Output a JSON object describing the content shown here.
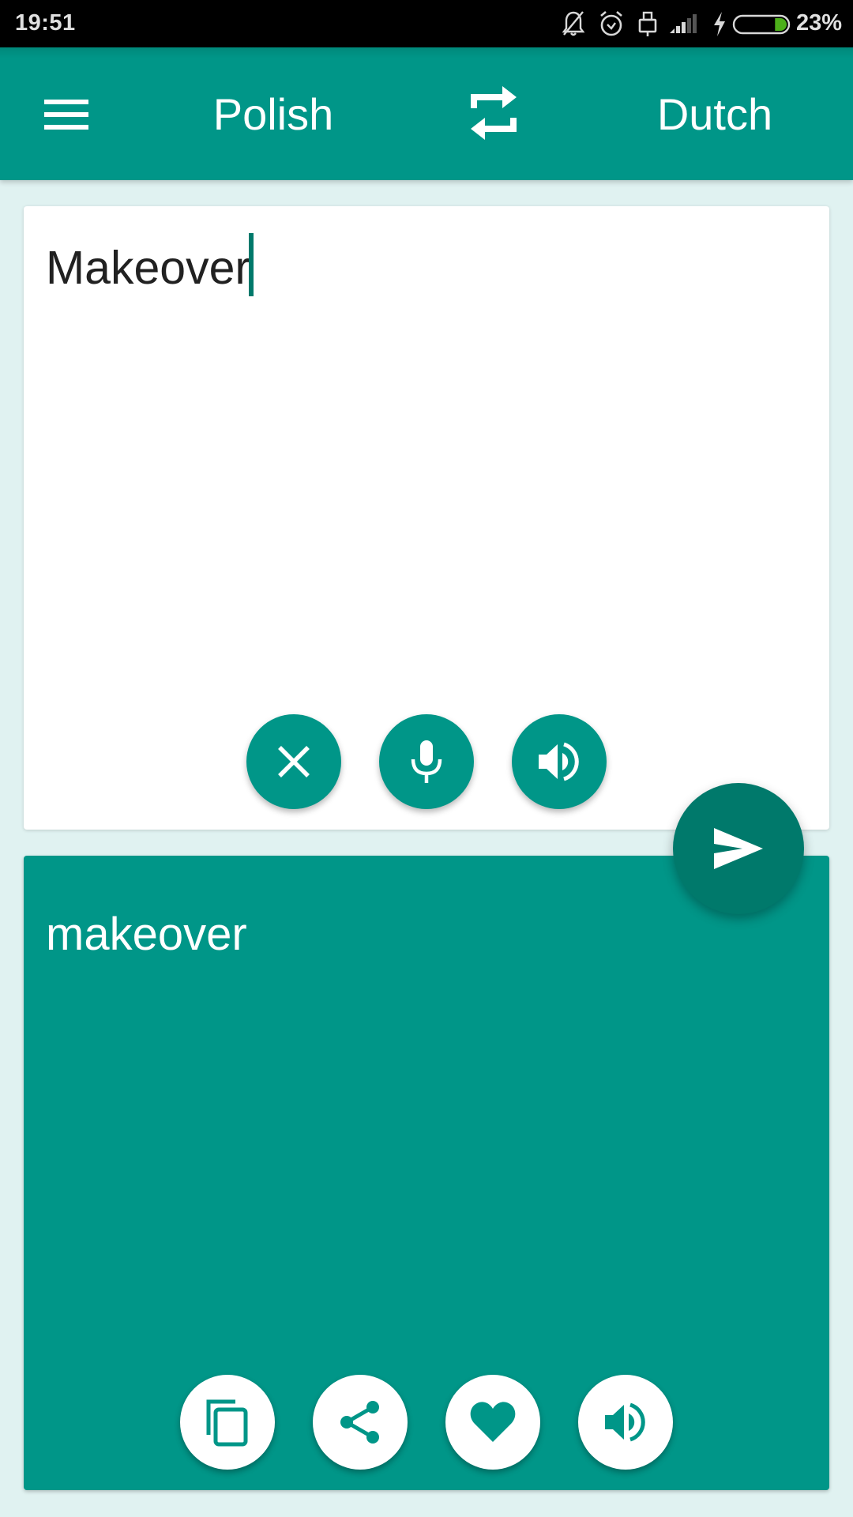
{
  "status_bar": {
    "time": "19:51",
    "battery_percent": "23%",
    "battery_level": 0.23,
    "icons": [
      "notifications-off-icon",
      "alarm-icon",
      "lock-icon",
      "signal-icon",
      "charging-icon",
      "battery-icon"
    ]
  },
  "toolbar": {
    "menu_icon": "hamburger-menu-icon",
    "source_language": "Polish",
    "swap_icon": "swap-languages-icon",
    "target_language": "Dutch"
  },
  "input_card": {
    "text": "Makeover",
    "actions": [
      {
        "name": "clear",
        "icon": "close-icon"
      },
      {
        "name": "voice-input",
        "icon": "microphone-icon"
      },
      {
        "name": "speak-input",
        "icon": "speaker-icon"
      }
    ]
  },
  "translate_button": {
    "icon": "send-icon"
  },
  "output_card": {
    "text": "makeover",
    "actions": [
      {
        "name": "copy",
        "icon": "copy-icon"
      },
      {
        "name": "share",
        "icon": "share-icon"
      },
      {
        "name": "favorite",
        "icon": "heart-icon"
      },
      {
        "name": "speak-output",
        "icon": "speaker-icon"
      }
    ]
  },
  "colors": {
    "primary": "#009688",
    "primary_dark": "#00796b",
    "background": "#e0f2f1",
    "battery_fill": "#4caf1a"
  }
}
